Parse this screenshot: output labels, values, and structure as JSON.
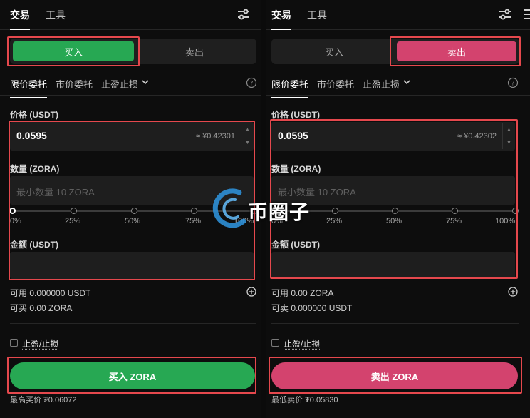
{
  "colors": {
    "buy": "#27a853",
    "sell": "#d3436e",
    "highlight": "#e5484d"
  },
  "left": {
    "top_tabs": [
      "交易",
      "工具"
    ],
    "side": {
      "buy": "买入",
      "sell": "卖出"
    },
    "order_tabs": {
      "limit": "限价委托",
      "market": "市价委托",
      "stop": "止盈止损"
    },
    "price_label": "价格 (USDT)",
    "price_value": "0.0595",
    "price_approx": "≈ ¥0.42301",
    "qty_label": "数量 (ZORA)",
    "qty_placeholder": "最小数量 10 ZORA",
    "slider_marks": [
      "0%",
      "25%",
      "50%",
      "75%",
      "100%"
    ],
    "amount_label": "金额 (USDT)",
    "available": "可用 0.000000 USDT",
    "max_trade": "可买 0.00 ZORA",
    "tp_sl": "止盈/止损",
    "action": "买入 ZORA",
    "best_price": "最高买价 ₮0.06072"
  },
  "right": {
    "top_tabs": [
      "交易",
      "工具"
    ],
    "side": {
      "buy": "买入",
      "sell": "卖出"
    },
    "order_tabs": {
      "limit": "限价委托",
      "market": "市价委托",
      "stop": "止盈止损"
    },
    "price_label": "价格 (USDT)",
    "price_value": "0.0595",
    "price_approx": "≈ ¥0.42302",
    "qty_label": "数量 (ZORA)",
    "qty_placeholder": "最小数量 10 ZORA",
    "slider_marks": [
      "0%",
      "25%",
      "50%",
      "75%",
      "100%"
    ],
    "amount_label": "金额 (USDT)",
    "available": "可用 0.00 ZORA",
    "max_trade": "可卖 0.000000 USDT",
    "tp_sl": "止盈/止损",
    "action": "卖出 ZORA",
    "best_price": "最低卖价 ₮0.05830"
  },
  "watermark": "币圈子"
}
